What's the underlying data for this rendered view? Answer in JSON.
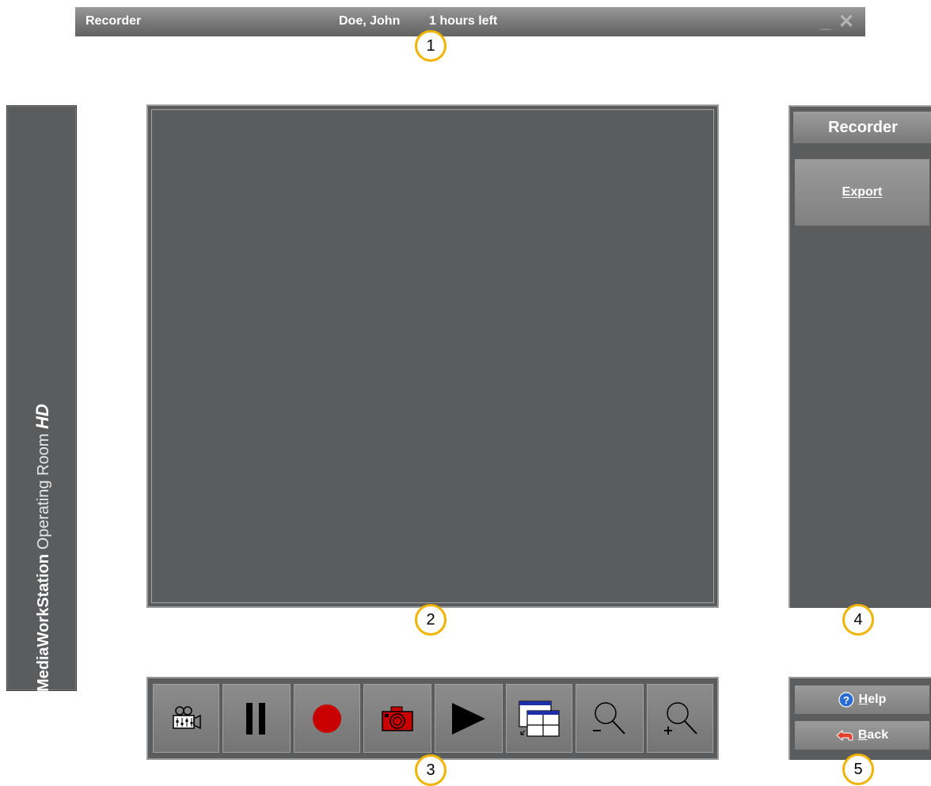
{
  "titlebar": {
    "app_title": "Recorder",
    "patient": "Doe, John",
    "time_left": "1 hours left",
    "minimize": "_",
    "close": "✕"
  },
  "brand": {
    "bold": "MediaWorkStation",
    "regular": " Operating Room ",
    "hd": "HD"
  },
  "right_panel": {
    "header": "Recorder",
    "export_label": "Export"
  },
  "toolbar": {
    "buttons": [
      {
        "icon": "camera-settings-icon"
      },
      {
        "icon": "pause-icon"
      },
      {
        "icon": "record-icon"
      },
      {
        "icon": "snapshot-camera-icon"
      },
      {
        "icon": "play-icon"
      },
      {
        "icon": "layout-windows-icon"
      },
      {
        "icon": "zoom-out-icon"
      },
      {
        "icon": "zoom-in-icon"
      }
    ]
  },
  "bottom_panel": {
    "help_label": "Help",
    "back_label": "Back"
  },
  "callouts": [
    "1",
    "2",
    "3",
    "4",
    "5"
  ]
}
